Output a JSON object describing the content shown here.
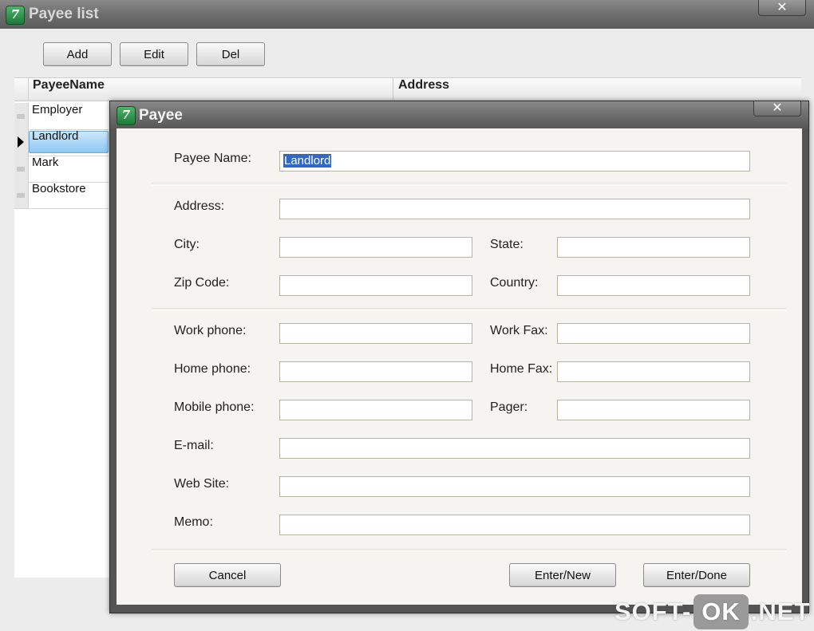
{
  "outer_window": {
    "title": "Payee list",
    "close_glyph": "✕",
    "icon_glyph": "7"
  },
  "toolbar": {
    "add": "Add",
    "edit": "Edit",
    "del": "Del"
  },
  "grid": {
    "columns": [
      "PayeeName",
      "Address"
    ],
    "rows": [
      {
        "name": "Employer",
        "selected": false
      },
      {
        "name": "Landlord",
        "selected": true
      },
      {
        "name": "Mark",
        "selected": false
      },
      {
        "name": "Bookstore",
        "selected": false
      }
    ]
  },
  "dialog": {
    "title": "Payee",
    "close_glyph": "✕",
    "fields": {
      "payee_name": {
        "label": "Payee Name:",
        "value": "Landlord"
      },
      "address": {
        "label": "Address:",
        "value": ""
      },
      "city": {
        "label": "City:",
        "value": ""
      },
      "state": {
        "label": "State:",
        "value": ""
      },
      "zip": {
        "label": "Zip Code:",
        "value": ""
      },
      "country": {
        "label": "Country:",
        "value": ""
      },
      "work_phone": {
        "label": "Work phone:",
        "value": ""
      },
      "work_fax": {
        "label": "Work Fax:",
        "value": ""
      },
      "home_phone": {
        "label": "Home phone:",
        "value": ""
      },
      "home_fax": {
        "label": "Home Fax:",
        "value": ""
      },
      "mobile_phone": {
        "label": "Mobile phone:",
        "value": ""
      },
      "pager": {
        "label": "Pager:",
        "value": ""
      },
      "email": {
        "label": "E-mail:",
        "value": ""
      },
      "web_site": {
        "label": "Web Site:",
        "value": ""
      },
      "memo": {
        "label": "Memo:",
        "value": ""
      }
    },
    "buttons": {
      "cancel": "Cancel",
      "enter_new": "Enter/New",
      "enter_done": "Enter/Done"
    }
  },
  "watermark": {
    "left": "SOFT-",
    "ok": "OK",
    "right": ".NET"
  },
  "colors": {
    "selection": "#3168c6",
    "row_selected": "#8cc8f2",
    "title_bar": "#6e6e6e"
  }
}
